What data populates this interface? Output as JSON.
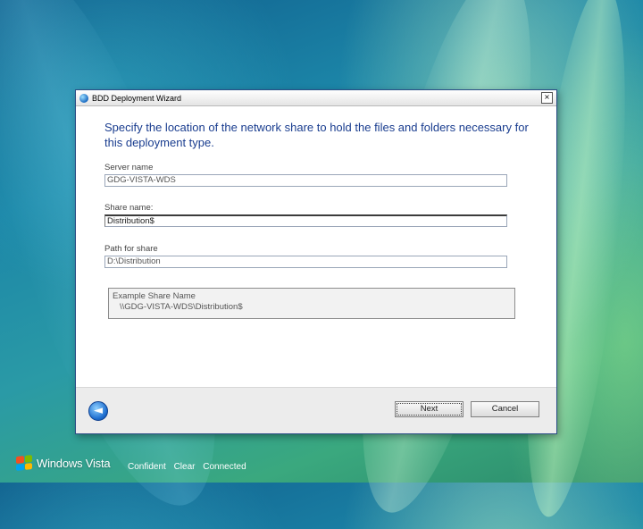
{
  "window": {
    "title": "BDD Deployment Wizard",
    "close_glyph": "×"
  },
  "heading": "Specify the location of the network share to hold the files and folders necessary for this deployment type.",
  "fields": [
    {
      "label": "Server name",
      "value": "GDG-VISTA-WDS"
    },
    {
      "label": "Share name:",
      "value": "Distribution$"
    },
    {
      "label": "Path for share",
      "value": "D:\\Distribution"
    }
  ],
  "example": {
    "title": "Example Share Name",
    "value": "\\\\GDG-VISTA-WDS\\Distribution$"
  },
  "buttons": {
    "back_icon": "back-arrow-icon",
    "back_glyph": "◄",
    "next": "Next",
    "cancel": "Cancel"
  },
  "desktop": {
    "brand": "Windows Vista",
    "tagline": "Confident Clear Connected"
  },
  "colors": {
    "heading": "#1a3d8f",
    "accent": "#2b4d86"
  }
}
